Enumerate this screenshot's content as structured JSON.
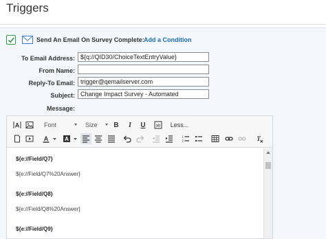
{
  "page": {
    "title": "Triggers"
  },
  "trigger": {
    "enabled": true,
    "send_email_label": "Send An Email On Survey Complete:",
    "add_condition_label": "Add a Condition"
  },
  "form": {
    "to_label": "To Email Address:",
    "to_value": "${q://QID30/ChoiceTextEntryValue}",
    "from_name_label": "From Name:",
    "from_name_value": "",
    "reply_to_label": "Reply-To Email:",
    "reply_to_value": "trigger@qemailserver.com",
    "subject_label": "Subject:",
    "subject_value": "Change Impact Survey - Automated",
    "message_label": "Message:"
  },
  "toolbar": {
    "font_label": "Font",
    "size_label": "Size",
    "bold": "B",
    "italic": "I",
    "underline": "U",
    "less_label": "Less..."
  },
  "message_lines": [
    {
      "text": "${e://Field/Q7}",
      "bold": true
    },
    {
      "text": "${e://Field/Q7%20Answer}",
      "bold": false
    },
    {
      "text": "${e://Field/Q8}",
      "bold": true
    },
    {
      "text": "${e://Field/Q8%20Answer}",
      "bold": false
    },
    {
      "text": "${e://Field/Q9}",
      "bold": true
    }
  ],
  "colors": {
    "link": "#1b6db5",
    "check": "#2f9a46",
    "mail_icon": "#3a7dc9",
    "panel_bg": "#f3f6fa"
  }
}
